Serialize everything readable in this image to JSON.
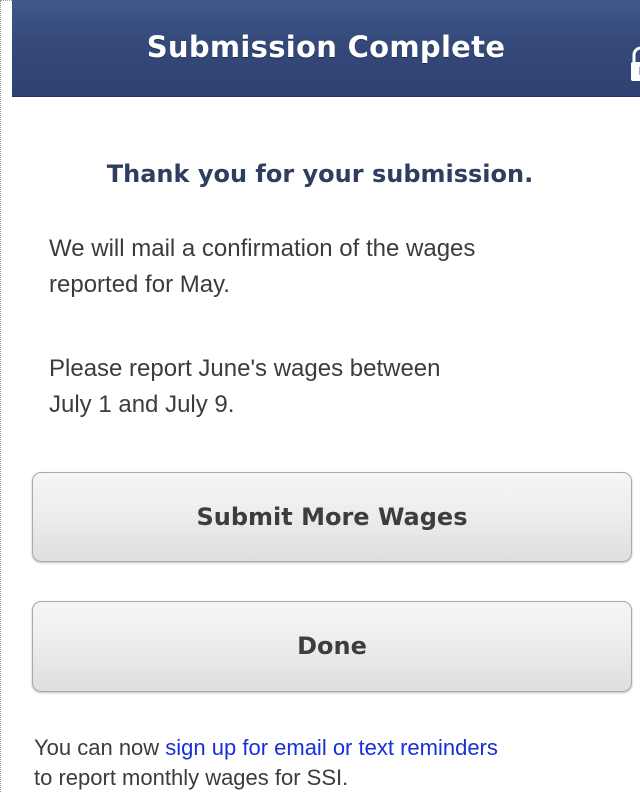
{
  "header": {
    "title": "Submission Complete",
    "lock_icon": "unlocked-padlock-icon"
  },
  "main": {
    "thank_you": "Thank you for your submission.",
    "confirmation_line1": "We will mail a confirmation of the wages",
    "confirmation_line2": "reported for May.",
    "next_report_line1": "Please report June's wages between",
    "next_report_line2": "July 1 and July 9."
  },
  "buttons": {
    "submit_more_label": "Submit More Wages",
    "done_label": "Done"
  },
  "footer": {
    "prefix": "You can now ",
    "link_text": "sign up for email or text reminders",
    "suffix": "to report monthly wages for SSI."
  },
  "colors": {
    "header_bg": "#34497a",
    "link": "#1a2fd6",
    "heading_text": "#2f3e5f"
  }
}
